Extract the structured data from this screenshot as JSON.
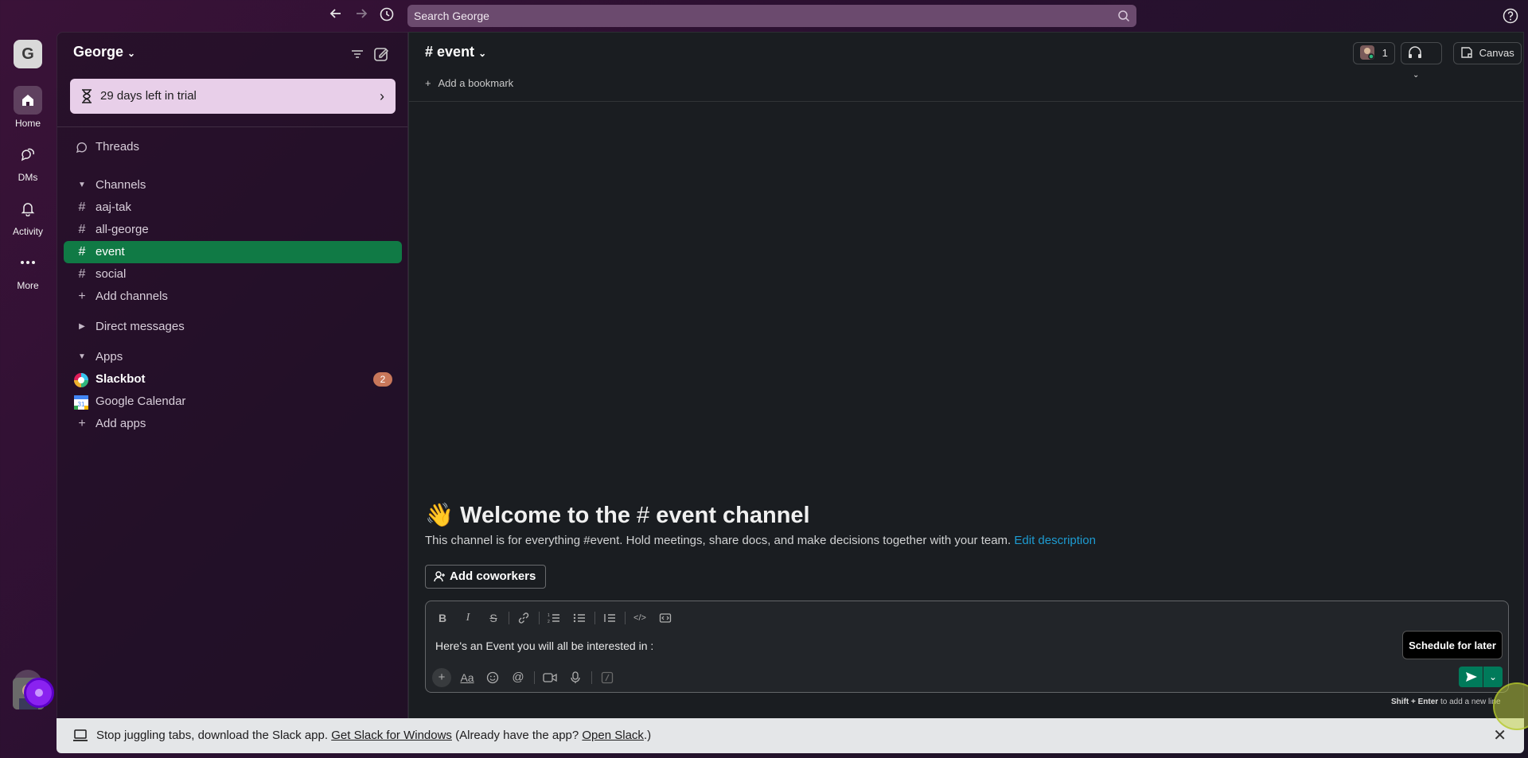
{
  "topbar": {
    "search_placeholder": "Search George"
  },
  "rail": {
    "workspace_initial": "G",
    "items": [
      {
        "label": "Home"
      },
      {
        "label": "DMs"
      },
      {
        "label": "Activity"
      },
      {
        "label": "More"
      }
    ]
  },
  "sidebar": {
    "workspace_name": "George",
    "trial_text": "29 days left in trial",
    "threads": "Threads",
    "channels_header": "Channels",
    "channels": [
      "aaj-tak",
      "all-george",
      "event",
      "social"
    ],
    "add_channels": "Add channels",
    "dm_header": "Direct messages",
    "apps_header": "Apps",
    "apps": [
      {
        "name": "Slackbot",
        "badge": "2"
      },
      {
        "name": "Google Calendar"
      }
    ],
    "add_apps": "Add apps"
  },
  "main": {
    "channel_title": "event",
    "huddle_count": "1",
    "canvas_label": "Canvas",
    "add_bookmark": "Add a bookmark",
    "welcome_prefix": "Welcome to the",
    "welcome_channel": "event channel",
    "description": "This channel is for everything #event. Hold meetings, share docs, and make decisions together with your team.",
    "edit_description": "Edit description",
    "add_coworkers": "Add coworkers",
    "composer_text": "Here's an Event you will all be interested in :",
    "tooltip": "Schedule for later",
    "hint_keys": "Shift + Enter",
    "hint_text": "to add a new line"
  },
  "banner": {
    "text": "Stop juggling tabs, download the Slack app.",
    "link1": "Get Slack for Windows",
    "mid": "(Already have the app?",
    "link2": "Open Slack",
    "end": ".)"
  },
  "colors": {
    "active_channel": "#107a45",
    "send_button": "#007a5a",
    "trial_bg": "#e8cfe9",
    "link": "#1d9bd1"
  }
}
